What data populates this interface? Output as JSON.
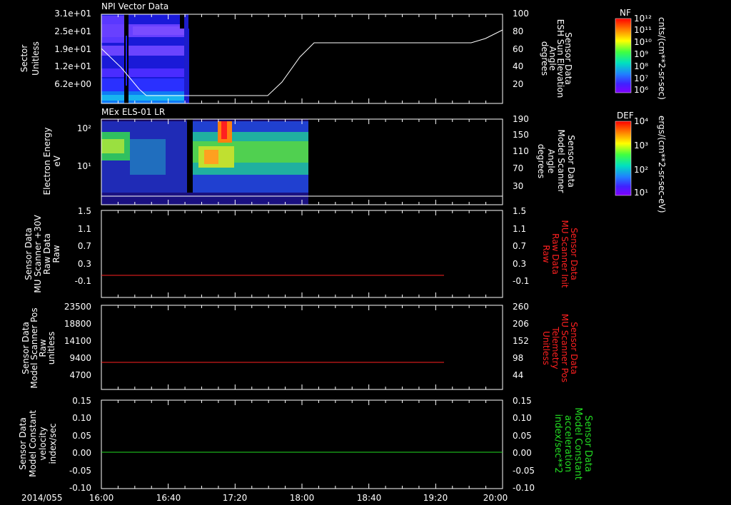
{
  "panels": [
    {
      "title": "NPI Vector Data",
      "left_label": [
        "Sector",
        "Unitless"
      ],
      "left_ticks": [
        "3.1e+01",
        "2.5e+01",
        "1.9e+01",
        "1.2e+01",
        "6.2e+00"
      ],
      "right_label": [
        "Sensor Data",
        "ESH Sun Elevation",
        "Angle",
        "degrees"
      ],
      "right_ticks": [
        "100",
        "80",
        "60",
        "40",
        "20"
      ]
    },
    {
      "title": "MEx ELS-01 LR",
      "left_label": [
        "Electron Energy",
        "eV"
      ],
      "left_ticks": [
        "10²",
        "10¹"
      ],
      "right_label": [
        "Sensor Data",
        "Model Scanner",
        "Angle",
        "degrees"
      ],
      "right_ticks": [
        "190",
        "150",
        "110",
        "70",
        "30"
      ]
    },
    {
      "left_label": [
        "Sensor Data",
        "MU Scanner +30V",
        "Raw Data",
        "Raw"
      ],
      "left_ticks": [
        "1.5",
        "1.1",
        "0.7",
        "0.3",
        "-0.1"
      ],
      "right_label": [
        "Sensor Data",
        "MU Scanner Init",
        "Raw Data",
        "Raw"
      ],
      "right_ticks": [
        "1.5",
        "1.1",
        "0.7",
        "0.3",
        "-0.1"
      ]
    },
    {
      "left_label": [
        "Sensor Data",
        "Model Scanner Pos",
        "Raw",
        "unitless"
      ],
      "left_ticks": [
        "23500",
        "18800",
        "14100",
        "9400",
        "4700"
      ],
      "right_label": [
        "Sensor Data",
        "MU Scanner Pos",
        "Telemetry",
        "Unitless"
      ],
      "right_ticks": [
        "260",
        "206",
        "152",
        "98",
        "44"
      ]
    },
    {
      "left_label": [
        "Sensor Data",
        "Model Constant",
        "velocity",
        "index/sec"
      ],
      "left_ticks": [
        "0.15",
        "0.10",
        "0.05",
        "0.00",
        "-0.05",
        "-0.10"
      ],
      "right_label": [
        "Sensor Data",
        "Model Constant",
        "acceleration",
        "index/sec**2"
      ],
      "right_ticks": [
        "0.15",
        "0.10",
        "0.05",
        "0.00",
        "-0.05",
        "-0.10"
      ]
    }
  ],
  "x_axis": {
    "date_label": "2014/055",
    "ticks": [
      "16:00",
      "16:40",
      "17:20",
      "18:00",
      "18:40",
      "19:20",
      "20:00"
    ]
  },
  "colorbars": [
    {
      "name": "NF",
      "unit": "cnts/(cm**2-sr-sec)",
      "labels": [
        "10¹²",
        "10¹¹",
        "10¹⁰",
        "10⁹",
        "10⁸",
        "10⁷",
        "10⁶"
      ]
    },
    {
      "name": "DEF",
      "unit": "ergs/(cm**2-sr-sec-eV)",
      "labels": [
        "10⁴",
        "10³",
        "10²",
        "10¹"
      ]
    }
  ],
  "colors": {
    "red": "#ff2020",
    "green": "#22dd22",
    "white": "#ffffff"
  },
  "chart_data": [
    {
      "type": "heatmap",
      "title": "NPI Vector Data",
      "ylabel": "Sector Unitless",
      "x_range": [
        "16:00",
        "20:00"
      ],
      "y_range": [
        0,
        31
      ],
      "data_extent": [
        "16:00",
        "16:50"
      ],
      "line_series": {
        "name": "Sensor Data ESH Sun Elevation Angle",
        "x": [
          "16:00",
          "16:20",
          "16:30",
          "17:20",
          "17:50",
          "18:10",
          "18:40",
          "19:20",
          "19:40",
          "20:00"
        ],
        "y": [
          60,
          35,
          5,
          5,
          5,
          60,
          65,
          65,
          65,
          80
        ],
        "ylim": [
          0,
          100
        ]
      }
    },
    {
      "type": "heatmap",
      "title": "MEx ELS-01 LR",
      "ylabel": "Electron Energy eV",
      "x_range": [
        "16:00",
        "20:00"
      ],
      "data_extent": [
        "16:00",
        "18:05"
      ],
      "line_series": {
        "name": "Sensor Data Model Scanner Angle",
        "x": [
          "16:00",
          "20:00"
        ],
        "y": [
          10,
          10
        ],
        "ylim": [
          0,
          190
        ]
      }
    },
    {
      "type": "line",
      "ylabel": "Sensor Data MU Scanner +30V Raw Data",
      "ylim": [
        -0.3,
        1.5
      ],
      "series": [
        {
          "name": "Sensor Data MU Scanner Init Raw Data",
          "x": [
            "16:00",
            "19:25"
          ],
          "y": [
            0,
            0
          ]
        }
      ]
    },
    {
      "type": "line",
      "ylabel": "Sensor Data Model Scanner Pos",
      "ylim": [
        0,
        23500
      ],
      "series": [
        {
          "name": "Sensor Data MU Scanner Pos Telemetry",
          "x": [
            "16:00",
            "19:25"
          ],
          "y": [
            7700,
            7700
          ]
        }
      ]
    },
    {
      "type": "line",
      "ylabel": "Sensor Data Model Constant velocity",
      "ylim": [
        -0.1,
        0.15
      ],
      "series": [
        {
          "name": "Sensor Data Model Constant acceleration",
          "x": [
            "16:00",
            "20:00"
          ],
          "y": [
            0,
            0
          ]
        }
      ]
    }
  ]
}
